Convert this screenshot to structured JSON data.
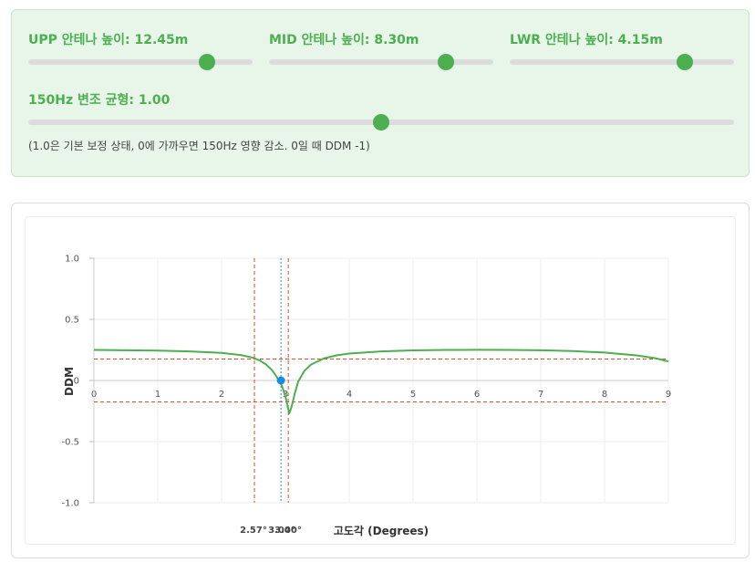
{
  "controls": {
    "upp": {
      "label": "UPP 안테나 높이: 12.45m",
      "fraction": 0.797
    },
    "mid": {
      "label": "MID 안테나 높이: 8.30m",
      "fraction": 0.789
    },
    "lwr": {
      "label": "LWR 안테나 높이: 4.15m",
      "fraction": 0.78
    },
    "balance": {
      "label": "150Hz 변조 균형: 1.00",
      "fraction": 0.5
    },
    "note": "(1.0은 기본 보정 상태, 0에 가까우면 150Hz 영향 감소. 0일 때 DDM -1)",
    "accent_color": "#4caf50"
  },
  "chart_data": {
    "type": "line",
    "title": "",
    "xlabel": "고도각 (Degrees)",
    "ylabel": "DDM",
    "xlim": [
      0,
      9
    ],
    "ylim": [
      -1.0,
      1.0
    ],
    "x_ticks": [
      "0",
      "1",
      "2",
      "3",
      "4",
      "5",
      "6",
      "7",
      "8",
      "9"
    ],
    "y_ticks": [
      "1.0",
      "0.5",
      "0",
      "-0.5",
      "-1.0"
    ],
    "grid": true,
    "series": [
      {
        "color": "#4caf50",
        "x": [
          0,
          0.5,
          1,
          1.5,
          2,
          2.3,
          2.5,
          2.6,
          2.7,
          2.8,
          2.9,
          2.95,
          3.0,
          3.03,
          3.06,
          3.1,
          3.15,
          3.2,
          3.3,
          3.4,
          3.6,
          3.8,
          4,
          4.5,
          5,
          5.5,
          6,
          6.5,
          7,
          7.5,
          8,
          8.5,
          8.8,
          9.0
        ],
        "values": [
          0.25,
          0.247,
          0.244,
          0.238,
          0.225,
          0.208,
          0.185,
          0.163,
          0.13,
          0.08,
          0.0,
          -0.05,
          -0.13,
          -0.2,
          -0.27,
          -0.21,
          -0.1,
          -0.01,
          0.08,
          0.13,
          0.18,
          0.205,
          0.22,
          0.238,
          0.246,
          0.25,
          0.251,
          0.25,
          0.247,
          0.24,
          0.228,
          0.205,
          0.182,
          0.155
        ]
      }
    ],
    "marker": {
      "x": 2.93,
      "y": 0.0,
      "color": "#1e88e5"
    },
    "reference_lines": {
      "vertical_red": [
        2.515,
        3.045
      ],
      "vertical_blue": [
        2.93
      ],
      "horizontal_red": [
        0.175,
        -0.175
      ]
    },
    "annotations": [
      "2.57°",
      "3.00°",
      "3.40°"
    ]
  }
}
